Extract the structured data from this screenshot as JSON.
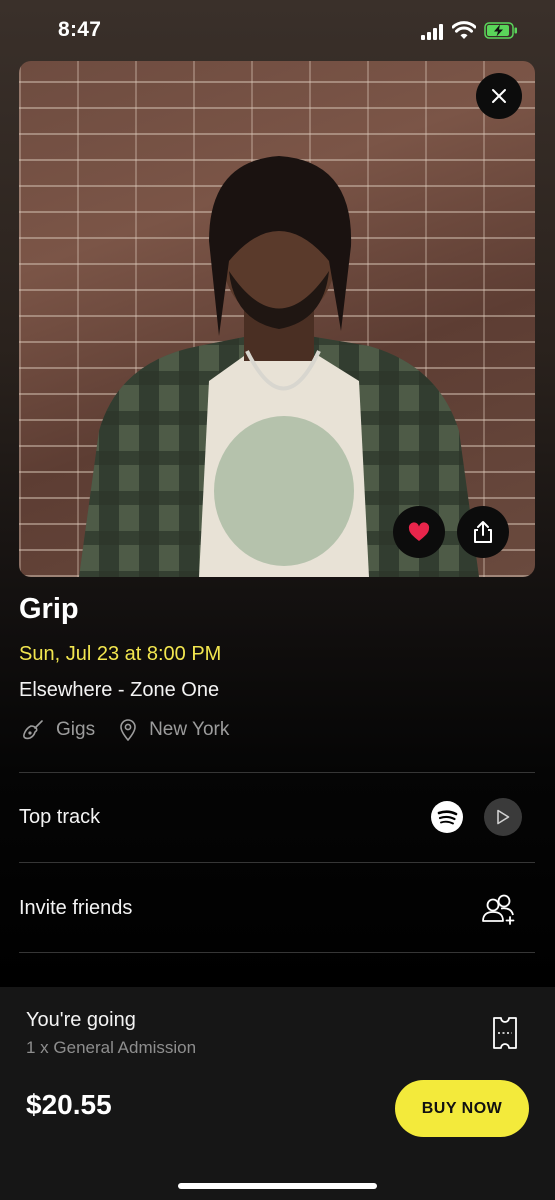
{
  "status_bar": {
    "time": "8:47"
  },
  "hero": {
    "image_icon": "artist-photo",
    "close_icon": "close-icon",
    "like_icon": "heart-icon",
    "share_icon": "share-icon"
  },
  "event": {
    "title": "Grip",
    "date": "Sun, Jul 23 at 8:00 PM",
    "venue": "Elsewhere - Zone One",
    "tags": [
      {
        "icon": "guitar-icon",
        "label": "Gigs"
      },
      {
        "icon": "location-pin-icon",
        "label": "New York"
      }
    ]
  },
  "top_track": {
    "label": "Top track",
    "spotify_icon": "spotify-icon",
    "play_icon": "play-icon"
  },
  "invite": {
    "label": "Invite friends",
    "icon": "add-friends-icon"
  },
  "booking": {
    "status": "You're going",
    "ticket_summary": "1 x General Admission",
    "price": "$20.55",
    "buy_label": "BUY NOW",
    "ticket_icon": "ticket-icon"
  },
  "colors": {
    "accent_yellow": "#f3ea3b",
    "date_yellow": "#f2e64f",
    "like_red": "#e8254b",
    "battery_green": "#5ad65a"
  }
}
